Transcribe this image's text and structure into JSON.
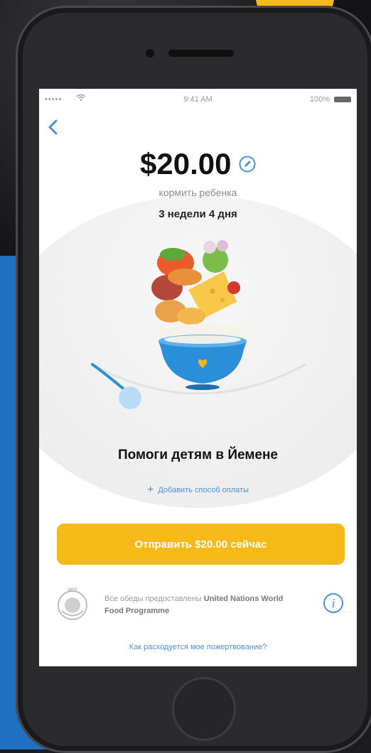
{
  "status_bar": {
    "signal": "•••••",
    "time": "9:41 AM",
    "battery": "100%"
  },
  "donation": {
    "amount": "$20.00",
    "purpose": "кормить ребенка",
    "duration": "3 недели 4 дня",
    "slider_fraction": 0.12
  },
  "campaign": {
    "title": "Помоги детям в Йемене"
  },
  "payment": {
    "add_label": "Добавить способ оплаты"
  },
  "send_button": {
    "label": "Отправить $20.00 сейчас"
  },
  "provider": {
    "logo_label": "WFP",
    "prefix": "Все обеды предоставлены ",
    "name": "United Nations World Food Programme"
  },
  "footer": {
    "how_link": "Как расходуется мое пожертвование?"
  },
  "colors": {
    "accent": "#f7b918",
    "link": "#4a90d9",
    "bowl": "#2a8fd8"
  },
  "icons": [
    "back-chevron-icon",
    "edit-pencil-icon",
    "plus-icon",
    "info-icon",
    "wfp-logo-icon"
  ]
}
